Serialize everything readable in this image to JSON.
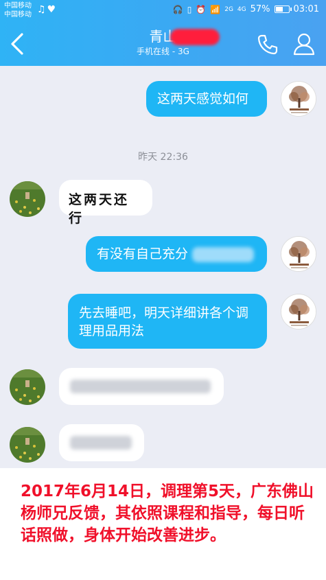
{
  "status_bar": {
    "carrier_1": "中国移动",
    "carrier_2": "中国移动",
    "network_1": "2G",
    "network_2": "4G",
    "battery_percent": "57%",
    "battery_level": 0.57,
    "time": "03:01"
  },
  "nav": {
    "title": "青山",
    "subtitle": "手机在线 - 3G"
  },
  "chat": {
    "timestamp": "昨天 22:36",
    "messages": [
      {
        "side": "out",
        "text": "这两天感觉如何"
      },
      {
        "side": "in",
        "text": "这两天还行"
      },
      {
        "side": "out",
        "text": "有没有自己充分"
      },
      {
        "side": "out",
        "text": "先去睡吧，明天详细讲各个调理用品用法"
      },
      {
        "side": "in",
        "text": ""
      },
      {
        "side": "in",
        "text": ""
      }
    ]
  },
  "caption": "2017年6月14日，调理第5天，广东佛山杨师兄反馈，其依照课程和指导，每日听话照做，身体开始改善进步。",
  "colors": {
    "header": "#3aa9f3",
    "bubble_out": "#1fb6f5",
    "chat_bg": "#ebedf5",
    "caption": "#f0102a"
  }
}
